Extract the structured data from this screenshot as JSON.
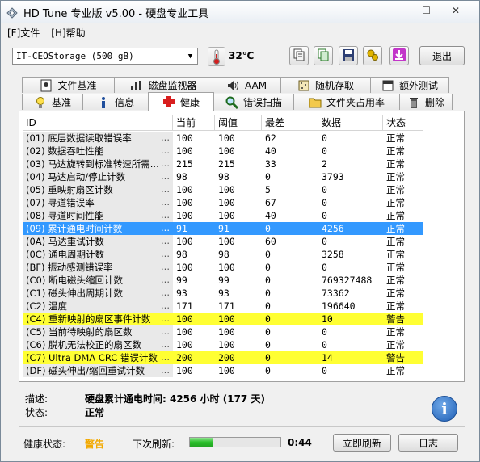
{
  "window": {
    "title": "HD Tune 专业版 v5.00 - 硬盘专业工具"
  },
  "menu": {
    "items": [
      "[F]文件",
      "[H]帮助"
    ]
  },
  "toolbar": {
    "drive": "IT-CEOStorage (500 gB)",
    "temperature": "32℃",
    "exit_label": "退出",
    "buttons": [
      "copy-text-icon",
      "copy-screenshot-icon",
      "save-icon",
      "options-icon",
      "download-icon"
    ]
  },
  "tabs_row1": [
    {
      "label": "文件基准",
      "icon": "file-benchmark-icon"
    },
    {
      "label": "磁盘监视器",
      "icon": "disk-monitor-icon"
    },
    {
      "label": "AAM",
      "icon": "speaker-icon"
    },
    {
      "label": "随机存取",
      "icon": "random-access-icon"
    },
    {
      "label": "额外测试",
      "icon": "extra-tests-icon"
    }
  ],
  "tabs_row2": [
    {
      "label": "基准",
      "icon": "benchmark-icon"
    },
    {
      "label": "信息",
      "icon": "info-icon"
    },
    {
      "label": "健康",
      "icon": "health-cross-icon",
      "active": true
    },
    {
      "label": "错误扫描",
      "icon": "error-scan-icon"
    },
    {
      "label": "文件夹占用率",
      "icon": "folder-icon"
    },
    {
      "label": "删除",
      "icon": "trash-icon"
    }
  ],
  "table": {
    "headers": [
      "ID",
      "当前",
      "阈值",
      "最差",
      "数据",
      "状态"
    ],
    "rows": [
      {
        "id": "(01) 底层数据读取错误率",
        "cur": "100",
        "th": "100",
        "worst": "62",
        "data": "0",
        "status": "正常"
      },
      {
        "id": "(02) 数据吞吐性能",
        "cur": "100",
        "th": "100",
        "worst": "40",
        "data": "0",
        "status": "正常"
      },
      {
        "id": "(03) 马达旋转到标准转速所需...",
        "cur": "215",
        "th": "215",
        "worst": "33",
        "data": "2",
        "status": "正常"
      },
      {
        "id": "(04) 马达启动/停止计数",
        "cur": "98",
        "th": "98",
        "worst": "0",
        "data": "3793",
        "status": "正常"
      },
      {
        "id": "(05) 重映射扇区计数",
        "cur": "100",
        "th": "100",
        "worst": "5",
        "data": "0",
        "status": "正常"
      },
      {
        "id": "(07) 寻道错误率",
        "cur": "100",
        "th": "100",
        "worst": "67",
        "data": "0",
        "status": "正常"
      },
      {
        "id": "(08) 寻道时间性能",
        "cur": "100",
        "th": "100",
        "worst": "40",
        "data": "0",
        "status": "正常"
      },
      {
        "id": "(09) 累计通电时间计数",
        "cur": "91",
        "th": "91",
        "worst": "0",
        "data": "4256",
        "status": "正常",
        "state": "sel"
      },
      {
        "id": "(0A) 马达重试计数",
        "cur": "100",
        "th": "100",
        "worst": "60",
        "data": "0",
        "status": "正常"
      },
      {
        "id": "(0C) 通电周期计数",
        "cur": "98",
        "th": "98",
        "worst": "0",
        "data": "3258",
        "status": "正常"
      },
      {
        "id": "(BF) 振动感测错误率",
        "cur": "100",
        "th": "100",
        "worst": "0",
        "data": "0",
        "status": "正常"
      },
      {
        "id": "(C0) 断电磁头缩回计数",
        "cur": "99",
        "th": "99",
        "worst": "0",
        "data": "769327488",
        "status": "正常"
      },
      {
        "id": "(C1) 磁头伸出周期计数",
        "cur": "93",
        "th": "93",
        "worst": "0",
        "data": "73362",
        "status": "正常"
      },
      {
        "id": "(C2) 温度",
        "cur": "171",
        "th": "171",
        "worst": "0",
        "data": "196640",
        "status": "正常"
      },
      {
        "id": "(C4) 重新映射的扇区事件计数",
        "cur": "100",
        "th": "100",
        "worst": "0",
        "data": "10",
        "status": "警告",
        "state": "warn"
      },
      {
        "id": "(C5) 当前待映射的扇区数",
        "cur": "100",
        "th": "100",
        "worst": "0",
        "data": "0",
        "status": "正常"
      },
      {
        "id": "(C6) 脱机无法校正的扇区数",
        "cur": "100",
        "th": "100",
        "worst": "0",
        "data": "0",
        "status": "正常"
      },
      {
        "id": "(C7) Ultra DMA CRC 错误计数",
        "cur": "200",
        "th": "200",
        "worst": "0",
        "data": "14",
        "status": "警告",
        "state": "warn"
      },
      {
        "id": "(DF) 磁头伸出/缩回重试计数",
        "cur": "100",
        "th": "100",
        "worst": "0",
        "data": "0",
        "status": "正常"
      }
    ]
  },
  "details": {
    "desc_label": "描述:",
    "desc_value": "硬盘累计通电时间: 4256 小时 (177 天)",
    "state_label": "状态:",
    "state_value": "正常"
  },
  "status": {
    "health_label": "健康状态:",
    "health_value": "警告",
    "health_color": "#f2a900",
    "next_refresh_label": "下次刷新:",
    "progress": 0.25,
    "countdown": "0:44",
    "refresh_button": "立即刷新",
    "log_button": "日志"
  },
  "colors": {
    "selected": "#3399ff",
    "warning": "#ffff33"
  }
}
